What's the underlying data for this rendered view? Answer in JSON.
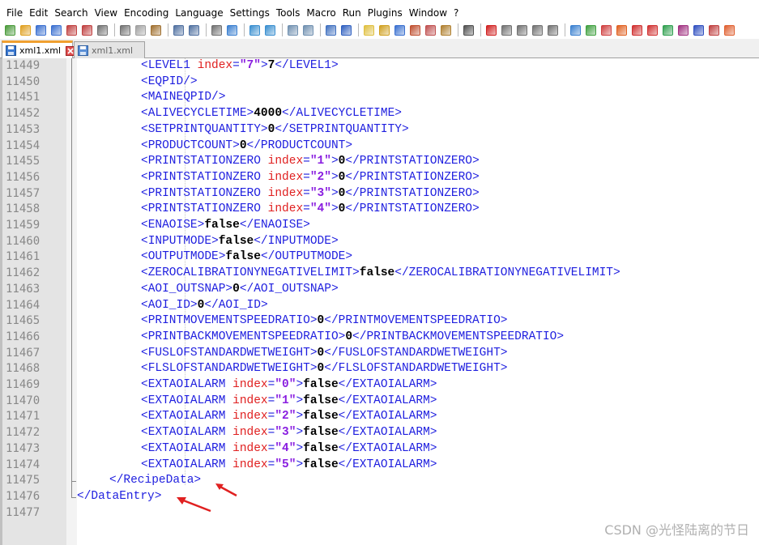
{
  "menu": [
    "File",
    "Edit",
    "Search",
    "View",
    "Encoding",
    "Language",
    "Settings",
    "Tools",
    "Macro",
    "Run",
    "Plugins",
    "Window",
    "?"
  ],
  "tabs": [
    {
      "label": "xml1.xml",
      "active": true
    },
    {
      "label": "xml1.xml",
      "active": false
    }
  ],
  "lines": [
    {
      "num": "11449",
      "indent": 2,
      "parts": [
        [
          "t",
          "<LEVEL1 "
        ],
        [
          "a",
          "index"
        ],
        [
          "t",
          "="
        ],
        [
          "v",
          "\"7\""
        ],
        [
          "t",
          ">"
        ],
        [
          "x",
          "7"
        ],
        [
          "t",
          "</LEVEL1>"
        ]
      ]
    },
    {
      "num": "11450",
      "indent": 2,
      "parts": [
        [
          "t",
          "<EQPID/>"
        ]
      ]
    },
    {
      "num": "11451",
      "indent": 2,
      "parts": [
        [
          "t",
          "<MAINEQPID/>"
        ]
      ]
    },
    {
      "num": "11452",
      "indent": 2,
      "parts": [
        [
          "t",
          "<ALIVECYCLETIME>"
        ],
        [
          "x",
          "4000"
        ],
        [
          "t",
          "</ALIVECYCLETIME>"
        ]
      ]
    },
    {
      "num": "11453",
      "indent": 2,
      "parts": [
        [
          "t",
          "<SETPRINTQUANTITY>"
        ],
        [
          "x",
          "0"
        ],
        [
          "t",
          "</SETPRINTQUANTITY>"
        ]
      ]
    },
    {
      "num": "11454",
      "indent": 2,
      "parts": [
        [
          "t",
          "<PRODUCTCOUNT>"
        ],
        [
          "x",
          "0"
        ],
        [
          "t",
          "</PRODUCTCOUNT>"
        ]
      ]
    },
    {
      "num": "11455",
      "indent": 2,
      "parts": [
        [
          "t",
          "<PRINTSTATIONZERO "
        ],
        [
          "a",
          "index"
        ],
        [
          "t",
          "="
        ],
        [
          "v",
          "\"1\""
        ],
        [
          "t",
          ">"
        ],
        [
          "x",
          "0"
        ],
        [
          "t",
          "</PRINTSTATIONZERO>"
        ]
      ]
    },
    {
      "num": "11456",
      "indent": 2,
      "parts": [
        [
          "t",
          "<PRINTSTATIONZERO "
        ],
        [
          "a",
          "index"
        ],
        [
          "t",
          "="
        ],
        [
          "v",
          "\"2\""
        ],
        [
          "t",
          ">"
        ],
        [
          "x",
          "0"
        ],
        [
          "t",
          "</PRINTSTATIONZERO>"
        ]
      ]
    },
    {
      "num": "11457",
      "indent": 2,
      "parts": [
        [
          "t",
          "<PRINTSTATIONZERO "
        ],
        [
          "a",
          "index"
        ],
        [
          "t",
          "="
        ],
        [
          "v",
          "\"3\""
        ],
        [
          "t",
          ">"
        ],
        [
          "x",
          "0"
        ],
        [
          "t",
          "</PRINTSTATIONZERO>"
        ]
      ]
    },
    {
      "num": "11458",
      "indent": 2,
      "parts": [
        [
          "t",
          "<PRINTSTATIONZERO "
        ],
        [
          "a",
          "index"
        ],
        [
          "t",
          "="
        ],
        [
          "v",
          "\"4\""
        ],
        [
          "t",
          ">"
        ],
        [
          "x",
          "0"
        ],
        [
          "t",
          "</PRINTSTATIONZERO>"
        ]
      ]
    },
    {
      "num": "11459",
      "indent": 2,
      "parts": [
        [
          "t",
          "<ENAOISE>"
        ],
        [
          "x",
          "false"
        ],
        [
          "t",
          "</ENAOISE>"
        ]
      ]
    },
    {
      "num": "11460",
      "indent": 2,
      "parts": [
        [
          "t",
          "<INPUTMODE>"
        ],
        [
          "x",
          "false"
        ],
        [
          "t",
          "</INPUTMODE>"
        ]
      ]
    },
    {
      "num": "11461",
      "indent": 2,
      "parts": [
        [
          "t",
          "<OUTPUTMODE>"
        ],
        [
          "x",
          "false"
        ],
        [
          "t",
          "</OUTPUTMODE>"
        ]
      ]
    },
    {
      "num": "11462",
      "indent": 2,
      "parts": [
        [
          "t",
          "<ZEROCALIBRATIONYNEGATIVELIMIT>"
        ],
        [
          "x",
          "false"
        ],
        [
          "t",
          "</ZEROCALIBRATIONYNEGATIVELIMIT>"
        ]
      ]
    },
    {
      "num": "11463",
      "indent": 2,
      "parts": [
        [
          "t",
          "<AOI_OUTSNAP>"
        ],
        [
          "x",
          "0"
        ],
        [
          "t",
          "</AOI_OUTSNAP>"
        ]
      ]
    },
    {
      "num": "11464",
      "indent": 2,
      "parts": [
        [
          "t",
          "<AOI_ID>"
        ],
        [
          "x",
          "0"
        ],
        [
          "t",
          "</AOI_ID>"
        ]
      ]
    },
    {
      "num": "11465",
      "indent": 2,
      "parts": [
        [
          "t",
          "<PRINTMOVEMENTSPEEDRATIO>"
        ],
        [
          "x",
          "0"
        ],
        [
          "t",
          "</PRINTMOVEMENTSPEEDRATIO>"
        ]
      ]
    },
    {
      "num": "11466",
      "indent": 2,
      "parts": [
        [
          "t",
          "<PRINTBACKMOVEMENTSPEEDRATIO>"
        ],
        [
          "x",
          "0"
        ],
        [
          "t",
          "</PRINTBACKMOVEMENTSPEEDRATIO>"
        ]
      ]
    },
    {
      "num": "11467",
      "indent": 2,
      "parts": [
        [
          "t",
          "<FUSLOFSTANDARDWETWEIGHT>"
        ],
        [
          "x",
          "0"
        ],
        [
          "t",
          "</FUSLOFSTANDARDWETWEIGHT>"
        ]
      ]
    },
    {
      "num": "11468",
      "indent": 2,
      "parts": [
        [
          "t",
          "<FLSLOFSTANDARDWETWEIGHT>"
        ],
        [
          "x",
          "0"
        ],
        [
          "t",
          "</FLSLOFSTANDARDWETWEIGHT>"
        ]
      ]
    },
    {
      "num": "11469",
      "indent": 2,
      "parts": [
        [
          "t",
          "<EXTAOIALARM "
        ],
        [
          "a",
          "index"
        ],
        [
          "t",
          "="
        ],
        [
          "v",
          "\"0\""
        ],
        [
          "t",
          ">"
        ],
        [
          "x",
          "false"
        ],
        [
          "t",
          "</EXTAOIALARM>"
        ]
      ]
    },
    {
      "num": "11470",
      "indent": 2,
      "parts": [
        [
          "t",
          "<EXTAOIALARM "
        ],
        [
          "a",
          "index"
        ],
        [
          "t",
          "="
        ],
        [
          "v",
          "\"1\""
        ],
        [
          "t",
          ">"
        ],
        [
          "x",
          "false"
        ],
        [
          "t",
          "</EXTAOIALARM>"
        ]
      ]
    },
    {
      "num": "11471",
      "indent": 2,
      "parts": [
        [
          "t",
          "<EXTAOIALARM "
        ],
        [
          "a",
          "index"
        ],
        [
          "t",
          "="
        ],
        [
          "v",
          "\"2\""
        ],
        [
          "t",
          ">"
        ],
        [
          "x",
          "false"
        ],
        [
          "t",
          "</EXTAOIALARM>"
        ]
      ]
    },
    {
      "num": "11472",
      "indent": 2,
      "parts": [
        [
          "t",
          "<EXTAOIALARM "
        ],
        [
          "a",
          "index"
        ],
        [
          "t",
          "="
        ],
        [
          "v",
          "\"3\""
        ],
        [
          "t",
          ">"
        ],
        [
          "x",
          "false"
        ],
        [
          "t",
          "</EXTAOIALARM>"
        ]
      ]
    },
    {
      "num": "11473",
      "indent": 2,
      "parts": [
        [
          "t",
          "<EXTAOIALARM "
        ],
        [
          "a",
          "index"
        ],
        [
          "t",
          "="
        ],
        [
          "v",
          "\"4\""
        ],
        [
          "t",
          ">"
        ],
        [
          "x",
          "false"
        ],
        [
          "t",
          "</EXTAOIALARM>"
        ]
      ]
    },
    {
      "num": "11474",
      "indent": 2,
      "parts": [
        [
          "t",
          "<EXTAOIALARM "
        ],
        [
          "a",
          "index"
        ],
        [
          "t",
          "="
        ],
        [
          "v",
          "\"5\""
        ],
        [
          "t",
          ">"
        ],
        [
          "x",
          "false"
        ],
        [
          "t",
          "</EXTAOIALARM>"
        ]
      ]
    },
    {
      "num": "11475",
      "indent": 1,
      "parts": [
        [
          "t",
          "</RecipeData>"
        ]
      ]
    },
    {
      "num": "11476",
      "indent": 0,
      "parts": [
        [
          "t",
          "</DataEntry>"
        ]
      ]
    },
    {
      "num": "11477",
      "indent": 0,
      "parts": []
    }
  ],
  "watermark": "CSDN @光怪陆离的节日",
  "colors": {
    "tag": "#1f1fdf",
    "attr": "#e02020",
    "value": "#8a1fe0",
    "text": "#000000",
    "annotation_arrow": "#e02020",
    "active_tab_accent": "#f0a030"
  },
  "icons": {
    "toolbar": [
      "new-file-icon",
      "open-file-icon",
      "save-icon",
      "save-all-icon",
      "close-icon",
      "close-all-icon",
      "print-icon",
      "cut-icon",
      "copy-icon",
      "paste-icon",
      "undo-icon",
      "redo-icon",
      "find-icon",
      "replace-icon",
      "zoom-in-icon",
      "zoom-out-icon",
      "sync-vertical-icon",
      "sync-horizontal-icon",
      "word-wrap-icon",
      "show-all-chars-icon",
      "indent-guide-icon",
      "doc-map-icon",
      "function-list-icon",
      "folder-workspace-icon",
      "monitoring-icon",
      "doc-switcher-icon",
      "preview-icon",
      "record-macro-icon",
      "stop-macro-icon",
      "play-macro-icon",
      "run-macro-multiple-icon",
      "save-macro-icon",
      "plugin-a-icon",
      "plugin-b-icon",
      "plugin-c-icon",
      "plugin-d-icon",
      "plugin-e-icon",
      "plugin-f-icon",
      "plugin-g-icon",
      "plugin-h-icon",
      "plugin-i-icon",
      "plugin-j-icon",
      "plugin-k-icon"
    ]
  }
}
